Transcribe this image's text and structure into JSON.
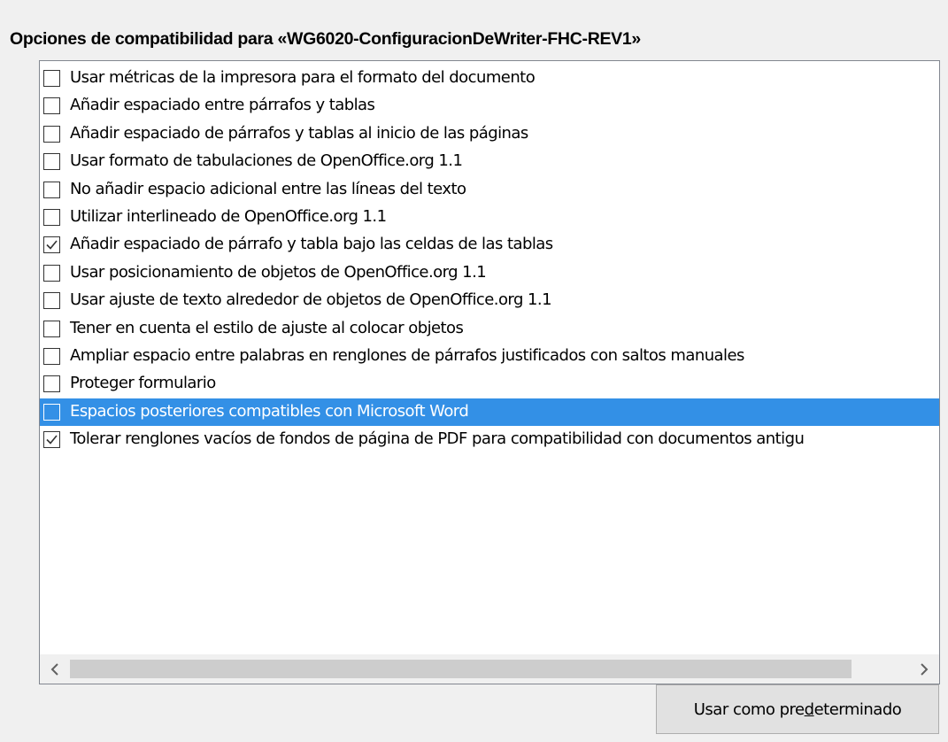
{
  "section": {
    "title": "Opciones de compatibilidad para «WG6020-ConfiguracionDeWriter-FHC-REV1»"
  },
  "options": [
    {
      "label": "Usar métricas de la impresora para el formato del documento",
      "checked": false,
      "selected": false
    },
    {
      "label": "Añadir espaciado entre párrafos y tablas",
      "checked": false,
      "selected": false
    },
    {
      "label": "Añadir espaciado de párrafos y tablas al inicio de las páginas",
      "checked": false,
      "selected": false
    },
    {
      "label": "Usar formato de tabulaciones de OpenOffice.org 1.1",
      "checked": false,
      "selected": false
    },
    {
      "label": "No añadir espacio adicional entre las líneas del texto",
      "checked": false,
      "selected": false
    },
    {
      "label": "Utilizar interlineado de OpenOffice.org 1.1",
      "checked": false,
      "selected": false
    },
    {
      "label": "Añadir espaciado de párrafo y tabla bajo las celdas de las tablas",
      "checked": true,
      "selected": false
    },
    {
      "label": "Usar posicionamiento de objetos de OpenOffice.org 1.1",
      "checked": false,
      "selected": false
    },
    {
      "label": "Usar ajuste de texto alrededor de objetos de OpenOffice.org 1.1",
      "checked": false,
      "selected": false
    },
    {
      "label": "Tener en cuenta el estilo de ajuste al colocar objetos",
      "checked": false,
      "selected": false
    },
    {
      "label": "Ampliar espacio entre palabras en renglones de párrafos justificados con saltos manuales",
      "checked": false,
      "selected": false
    },
    {
      "label": "Proteger formulario",
      "checked": false,
      "selected": false
    },
    {
      "label": "Espacios posteriores compatibles con Microsoft Word",
      "checked": false,
      "selected": true
    },
    {
      "label": "Tolerar renglones vacíos de fondos de página de PDF para compatibilidad con documentos antigu",
      "checked": true,
      "selected": false
    }
  ],
  "scrollbar": {
    "left_icon": "chevron-left-icon",
    "right_icon": "chevron-right-icon"
  },
  "button": {
    "label_before": "Usar como pre",
    "label_mnemonic": "d",
    "label_after": "eterminado"
  },
  "colors": {
    "selection": "#3390e6",
    "background": "#f0f0f0",
    "list_background": "#ffffff"
  }
}
